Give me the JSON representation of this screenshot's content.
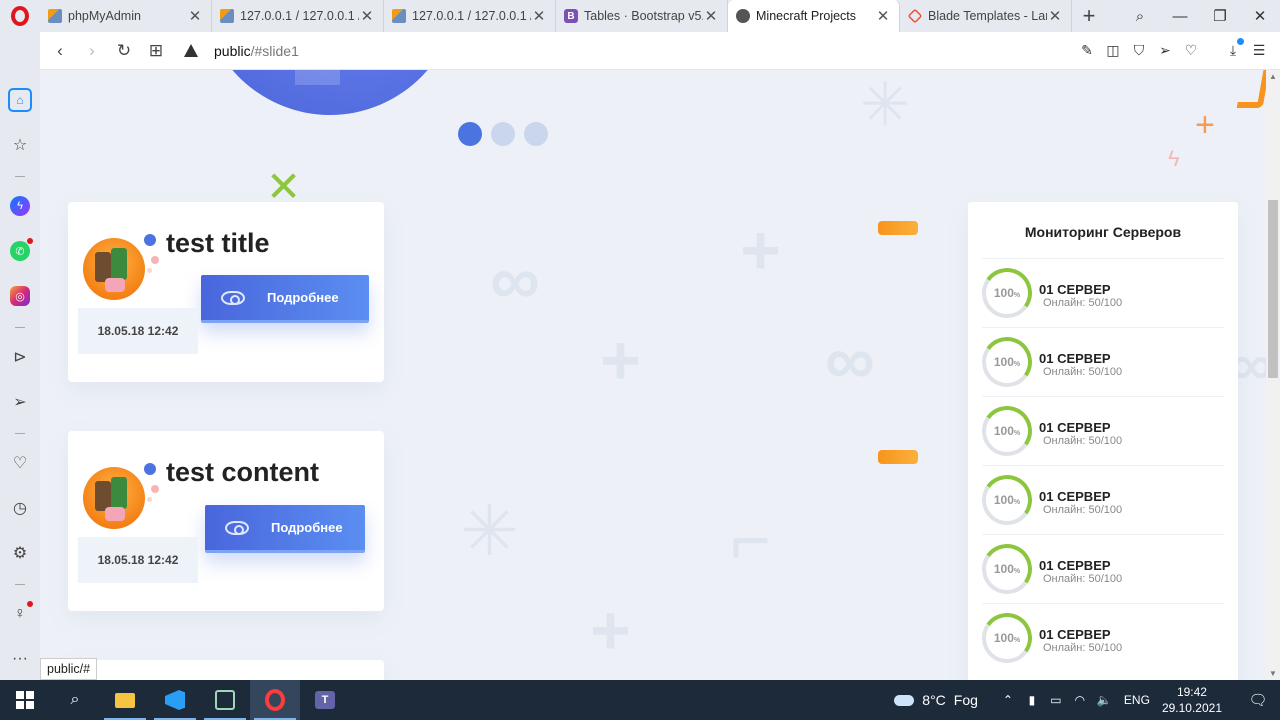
{
  "browser": {
    "tabs": [
      {
        "label": "phpMyAdmin",
        "icon": "phpmyadmin-icon",
        "fav": "pma",
        "active": false
      },
      {
        "label": "127.0.0.1 / 127.0.0.1 /",
        "icon": "phpmyadmin-icon",
        "fav": "pma",
        "active": false
      },
      {
        "label": "127.0.0.1 / 127.0.0.1 /",
        "icon": "phpmyadmin-icon",
        "fav": "pma",
        "active": false
      },
      {
        "label": "Tables · Bootstrap v5.",
        "icon": "bootstrap-icon",
        "fav": "bs",
        "active": false
      },
      {
        "label": "Minecraft Projects",
        "icon": "globe-icon",
        "fav": "globe",
        "active": true
      },
      {
        "label": "Blade Templates - Lar",
        "icon": "laravel-icon",
        "fav": "laravel",
        "active": false
      }
    ],
    "bootstrap_letter": "B",
    "tab_close_glyph": "✕",
    "new_tab_glyph": "+",
    "url_host": "public",
    "url_rest": "/#slide1",
    "status_tooltip": "public/#"
  },
  "slider": {
    "dot_count": 3,
    "active_index": 0
  },
  "cards": [
    {
      "title": "test title",
      "button_label": "Подробнее",
      "date": "18.05.18 12:42"
    },
    {
      "title": "test content",
      "button_label": "Подробнее",
      "date": "18.05.18 12:42"
    }
  ],
  "monitoring": {
    "title": "Мониторинг Серверов",
    "servers": [
      {
        "name": "01 СЕРВЕР",
        "percent": "100",
        "percent_sign": "%",
        "online": "Онлайн: 50/100"
      },
      {
        "name": "01 СЕРВЕР",
        "percent": "100",
        "percent_sign": "%",
        "online": "Онлайн: 50/100"
      },
      {
        "name": "01 СЕРВЕР",
        "percent": "100",
        "percent_sign": "%",
        "online": "Онлайн: 50/100"
      },
      {
        "name": "01 СЕРВЕР",
        "percent": "100",
        "percent_sign": "%",
        "online": "Онлайн: 50/100"
      },
      {
        "name": "01 СЕРВЕР",
        "percent": "100",
        "percent_sign": "%",
        "online": "Онлайн: 50/100"
      },
      {
        "name": "01 СЕРВЕР",
        "percent": "100",
        "percent_sign": "%",
        "online": "Онлайн: 50/100"
      }
    ]
  },
  "taskbar": {
    "weather_temp": "8°C",
    "weather_desc": "Fog",
    "language": "ENG",
    "time": "19:42",
    "date": "29.10.2021"
  },
  "colors": {
    "accent_blue": "#4b74e0",
    "ring_green": "#8cc63e",
    "opera_red": "#e0161e",
    "orange": "#f7941d"
  }
}
